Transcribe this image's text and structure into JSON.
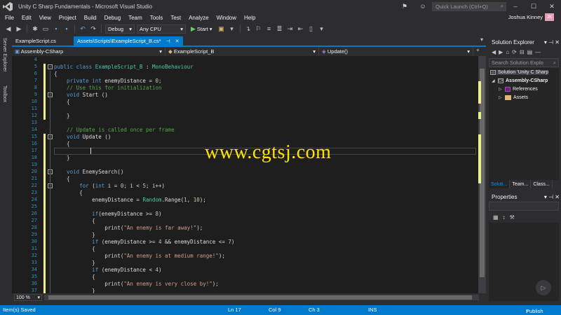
{
  "window": {
    "title": "Unity C Sharp Fundamentals - Microsoft Visual Studio",
    "quick_launch_placeholder": "Quick Launch (Ctrl+Q)",
    "user_name": "Joshua Kinney",
    "user_initials": "JK",
    "accent_color": "#007acc"
  },
  "menu": [
    "File",
    "Edit",
    "View",
    "Project",
    "Build",
    "Debug",
    "Team",
    "Tools",
    "Test",
    "Analyze",
    "Window",
    "Help"
  ],
  "toolbar": {
    "configuration": "Debug",
    "platform": "Any CPU",
    "start_label": "Start"
  },
  "left_strip": {
    "server_explorer": "Server Explorer",
    "toolbox": "Toolbox"
  },
  "doc_tabs": [
    {
      "label": "ExampleScript.cs",
      "active": false
    },
    {
      "label": "Assets\\Scripts\\ExampleScript_B.cs*",
      "active": true
    }
  ],
  "navbar": {
    "project": "Assembly-CSharp",
    "type": "ExampleScript_B",
    "member": "Update()"
  },
  "editor": {
    "line_numbers": [
      "4",
      "5",
      "6",
      "7",
      "8",
      "9",
      "10",
      "11",
      "12",
      "13",
      "14",
      "15",
      "16",
      "17",
      "18",
      "19",
      "20",
      "21",
      "22",
      "23",
      "24",
      "25",
      "26",
      "27",
      "28",
      "29",
      "30",
      "31",
      "32",
      "33",
      "34",
      "35",
      "36",
      "37"
    ],
    "lines": [
      [],
      [
        {
          "t": "kw",
          "s": "public class "
        },
        {
          "t": "ty",
          "s": "ExampleScript_B"
        },
        {
          "t": "",
          "s": " : "
        },
        {
          "t": "ty",
          "s": "MonoBehaviour"
        }
      ],
      [
        {
          "t": "",
          "s": "{"
        }
      ],
      [
        {
          "t": "kw",
          "s": "    private int "
        },
        {
          "t": "",
          "s": "enemyDistance = "
        },
        {
          "t": "nm",
          "s": "0"
        },
        {
          "t": "",
          "s": ";"
        }
      ],
      [
        {
          "t": "cm",
          "s": "    // Use this for initialization"
        }
      ],
      [
        {
          "t": "kw",
          "s": "    void "
        },
        {
          "t": "",
          "s": "Start ()"
        }
      ],
      [
        {
          "t": "",
          "s": "    {"
        }
      ],
      [],
      [
        {
          "t": "",
          "s": "    }"
        }
      ],
      [],
      [
        {
          "t": "cm",
          "s": "    // Update is called once per frame"
        }
      ],
      [
        {
          "t": "kw",
          "s": "    void "
        },
        {
          "t": "",
          "s": "Update ()"
        }
      ],
      [
        {
          "t": "",
          "s": "    {"
        }
      ],
      [],
      [
        {
          "t": "",
          "s": "    }"
        }
      ],
      [],
      [
        {
          "t": "kw",
          "s": "    void "
        },
        {
          "t": "",
          "s": "EnemySearch()"
        }
      ],
      [
        {
          "t": "",
          "s": "    {"
        }
      ],
      [
        {
          "t": "kw",
          "s": "        for "
        },
        {
          "t": "",
          "s": "("
        },
        {
          "t": "kw",
          "s": "int "
        },
        {
          "t": "",
          "s": "i = "
        },
        {
          "t": "nm",
          "s": "0"
        },
        {
          "t": "",
          "s": "; i < "
        },
        {
          "t": "nm",
          "s": "5"
        },
        {
          "t": "",
          "s": "; i++)"
        }
      ],
      [
        {
          "t": "",
          "s": "        {"
        }
      ],
      [
        {
          "t": "",
          "s": "            enemyDistance = "
        },
        {
          "t": "ty",
          "s": "Random"
        },
        {
          "t": "",
          "s": ".Range("
        },
        {
          "t": "nm",
          "s": "1"
        },
        {
          "t": "",
          "s": ", "
        },
        {
          "t": "nm",
          "s": "10"
        },
        {
          "t": "",
          "s": ");"
        }
      ],
      [],
      [
        {
          "t": "kw",
          "s": "            if"
        },
        {
          "t": "",
          "s": "(enemyDistance >= "
        },
        {
          "t": "nm",
          "s": "8"
        },
        {
          "t": "",
          "s": ")"
        }
      ],
      [
        {
          "t": "",
          "s": "            {"
        }
      ],
      [
        {
          "t": "",
          "s": "                print("
        },
        {
          "t": "st",
          "s": "\"An enemy is far away!\""
        },
        {
          "t": "",
          "s": ");"
        }
      ],
      [
        {
          "t": "",
          "s": "            }"
        }
      ],
      [
        {
          "t": "kw",
          "s": "            if "
        },
        {
          "t": "",
          "s": "(enemyDistance >= "
        },
        {
          "t": "nm",
          "s": "4"
        },
        {
          "t": "",
          "s": " && enemyDistance <= "
        },
        {
          "t": "nm",
          "s": "7"
        },
        {
          "t": "",
          "s": ")"
        }
      ],
      [
        {
          "t": "",
          "s": "            {"
        }
      ],
      [
        {
          "t": "",
          "s": "                print("
        },
        {
          "t": "st",
          "s": "\"An enemy is at medium range!\""
        },
        {
          "t": "",
          "s": ");"
        }
      ],
      [
        {
          "t": "",
          "s": "            }"
        }
      ],
      [
        {
          "t": "kw",
          "s": "            if "
        },
        {
          "t": "",
          "s": "(enemyDistance < "
        },
        {
          "t": "nm",
          "s": "4"
        },
        {
          "t": "",
          "s": ")"
        }
      ],
      [
        {
          "t": "",
          "s": "            {"
        }
      ],
      [
        {
          "t": "",
          "s": "                print("
        },
        {
          "t": "st",
          "s": "\"An enemy is very close by!\""
        },
        {
          "t": "",
          "s": ");"
        }
      ],
      [
        {
          "t": "",
          "s": "            }"
        }
      ]
    ],
    "zoom": "100 %"
  },
  "watermark": "www.cgtsj.com",
  "solution_explorer": {
    "title": "Solution Explorer",
    "search_placeholder": "Search Solution Explo",
    "solution": "Solution 'Unity C Sharp",
    "project": "Assembly-CSharp",
    "references": "References",
    "assets": "Assets",
    "tabs": [
      "Soluti...",
      "Team...",
      "Class..."
    ]
  },
  "properties": {
    "title": "Properties"
  },
  "status": {
    "message": "Item(s) Saved",
    "line": "Ln 17",
    "col": "Col 9",
    "ch": "Ch 3",
    "mode": "INS",
    "publish": "Publish"
  }
}
